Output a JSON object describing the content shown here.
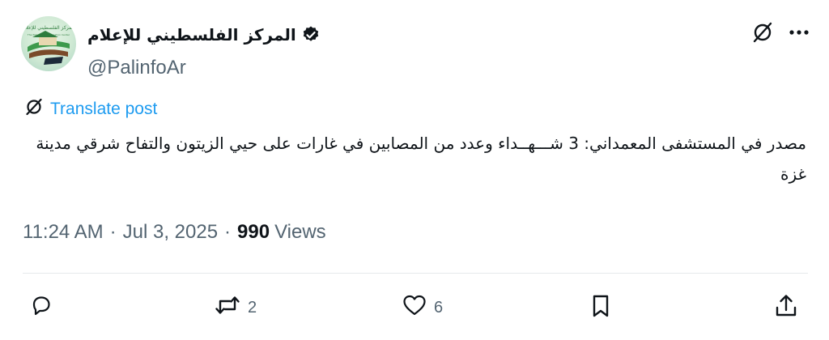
{
  "author": {
    "display_name": "المركز الفلسطيني للإعلام",
    "handle": "@PalinfoAr",
    "verified_icon": "verified-badge-icon",
    "avatar_brand_text": "المركز الفلسطيني للإعلام",
    "avatar_brand_subtext": "The Palestinian Information Center"
  },
  "translate": {
    "label": "Translate post"
  },
  "post": {
    "text": "مصدر في المستشفى المعمداني: 3 شـــهــداء وعدد من المصابين في غارات على حيي الزيتون والتفاح شرقي مدينة غزة"
  },
  "meta": {
    "time": "11:24 AM",
    "separator": "·",
    "date": "Jul 3, 2025",
    "views_count": "990",
    "views_label": "Views"
  },
  "actions": {
    "reply_count": "",
    "retweet_count": "2",
    "like_count": "6"
  },
  "colors": {
    "accent": "#1d9bf0",
    "muted": "#536471",
    "text": "#0f1419",
    "divider": "#e6e9eb"
  }
}
